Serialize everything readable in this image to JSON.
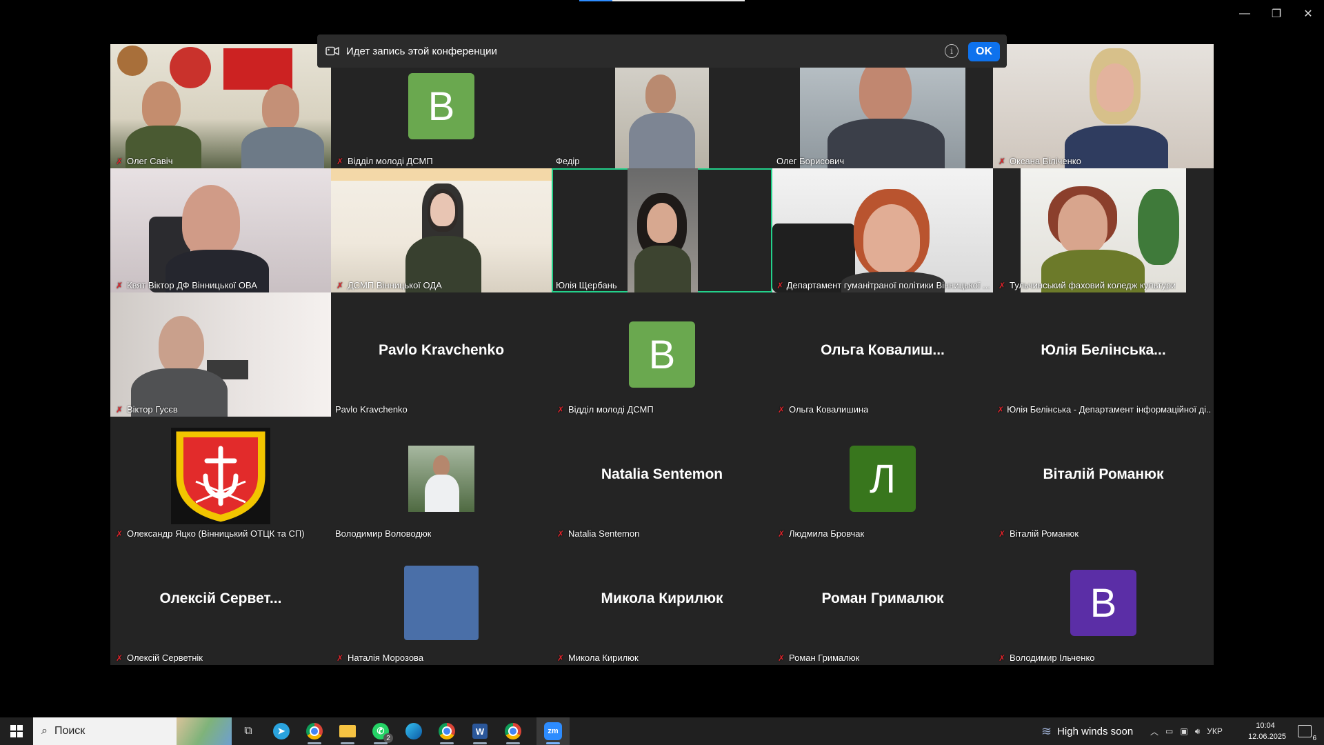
{
  "recording": {
    "text": "Идет запись этой конференции",
    "ok_label": "OK"
  },
  "tiles": [
    {
      "name": "Олег Савіч",
      "muted": true
    },
    {
      "name": "Відділ молоді ДСМП",
      "muted": true,
      "avatar_letter": "В",
      "avatar_color": "#6aa84f"
    },
    {
      "name": "Федір",
      "muted": false
    },
    {
      "name": "Олег Борисович",
      "muted": false
    },
    {
      "name": "Оксана Біліченко",
      "muted": true
    },
    {
      "name": "Квят Віктор ДФ Вінницької ОВА",
      "muted": true
    },
    {
      "name": "ДСМП Вінницької ОДА",
      "muted": true
    },
    {
      "name": "Юлія Щербань",
      "muted": false,
      "active": true
    },
    {
      "name": "Департамент гуманітраної політики Вінницької ...",
      "muted": true
    },
    {
      "name": "Тульчинський фаховий коледж культури",
      "muted": true
    },
    {
      "name": "Віктор Гусєв",
      "muted": true
    },
    {
      "name": "Pavlo Kravchenko",
      "muted": false,
      "display_name": "Pavlo Kravchenko"
    },
    {
      "name": "Відділ молоді ДСМП",
      "muted": true,
      "avatar_letter": "В",
      "avatar_color": "#6aa84f"
    },
    {
      "name": "Ольга Ковалишина",
      "muted": true,
      "display_name": "Ольга  Ковалиш..."
    },
    {
      "name": "Юлія Белінська - Департамент інформаційної ді...",
      "muted": true,
      "display_name": "Юлія Белінська..."
    },
    {
      "name": "Олександр Яцко (Вінницький ОТЦК та СП)",
      "muted": true
    },
    {
      "name": "Володимир Воловодюк",
      "muted": false
    },
    {
      "name": "Natalia Sentemon",
      "muted": true,
      "display_name": "Natalia Sentemon"
    },
    {
      "name": "Людмила Бровчак",
      "muted": true,
      "avatar_letter": "Л",
      "avatar_color": "#38761d"
    },
    {
      "name": "Віталій Романюк",
      "muted": true,
      "display_name": "Віталій Романюк"
    },
    {
      "name": "Олексій Серветнік",
      "muted": true,
      "display_name": "Олексій Сервет..."
    },
    {
      "name": "Наталія Морозова",
      "muted": true,
      "avatar_color": "#4a6fa8"
    },
    {
      "name": "Микола Кирилюк",
      "muted": true,
      "display_name": "Микола Кирилюк"
    },
    {
      "name": "Роман Грималюк",
      "muted": true,
      "display_name": "Роман Грималюк"
    },
    {
      "name": "Володимир Ільченко",
      "muted": true,
      "avatar_letter": "В",
      "avatar_color": "#5b2ea6"
    }
  ],
  "taskbar": {
    "search_placeholder": "Поиск",
    "whatsapp_badge": "2",
    "weather": "High winds soon",
    "language": "УКР",
    "time": "10:04",
    "date": "12.06.2025",
    "notifications": "6"
  },
  "colors": {
    "accent": "#0e72ed",
    "active_speaker": "#23d18b",
    "mute": "#e0242b"
  }
}
